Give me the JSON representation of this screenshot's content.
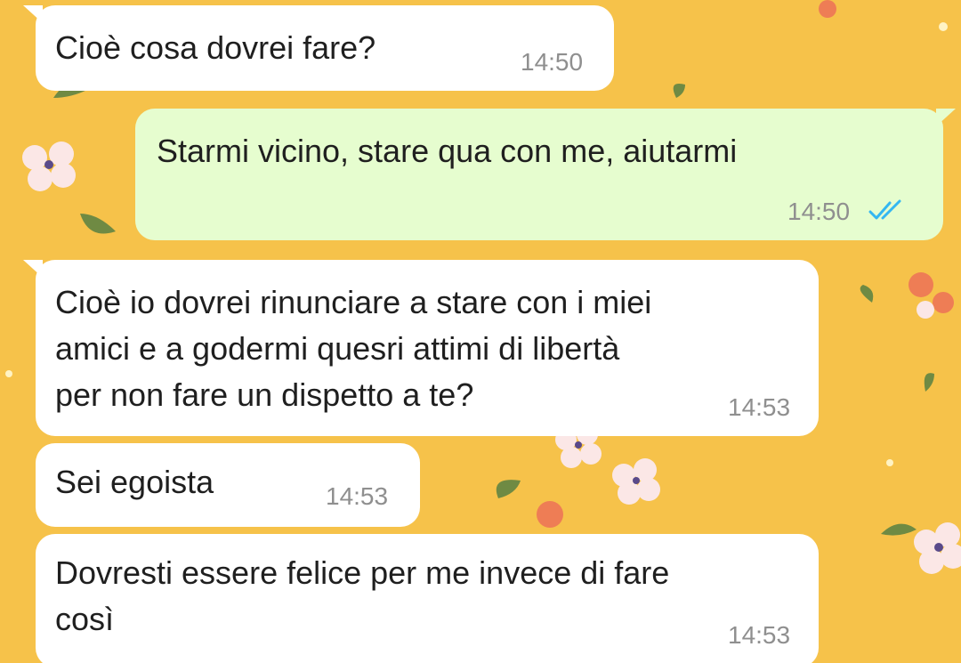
{
  "colors": {
    "wallpaper": "#f6c24a",
    "incoming_bubble": "#ffffff",
    "outgoing_bubble": "#e6fdcf",
    "timestamp": "#8f8f8f",
    "read_ticks": "#34b7f1"
  },
  "messages": [
    {
      "direction": "incoming",
      "lines": [
        "Cioè cosa dovrei fare?"
      ],
      "time": "14:50"
    },
    {
      "direction": "outgoing",
      "lines": [
        "Starmi vicino, stare qua con me, aiutarmi"
      ],
      "time": "14:50",
      "status_icon": "double-check-read-icon"
    },
    {
      "direction": "incoming",
      "lines": [
        "Cioè io dovrei rinunciare a stare con i miei",
        "amici e a godermi quesri attimi di libertà",
        "per non fare un dispetto a te?"
      ],
      "time": "14:53"
    },
    {
      "direction": "incoming",
      "lines": [
        "Sei egoista"
      ],
      "time": "14:53"
    },
    {
      "direction": "incoming",
      "lines": [
        "Dovresti essere felice per me invece di fare",
        "così"
      ],
      "time": "14:53"
    }
  ]
}
